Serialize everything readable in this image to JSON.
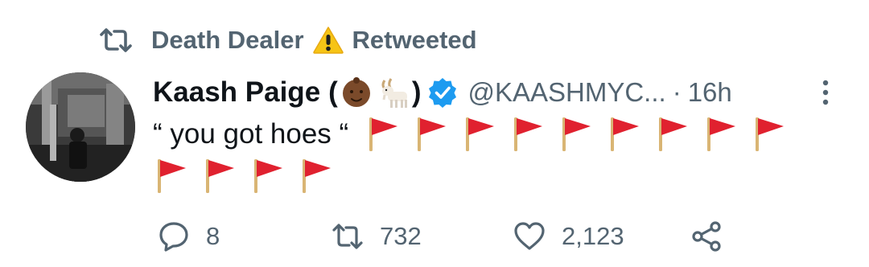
{
  "retweet_banner": {
    "retweeter_name": "Death Dealer",
    "warning_emoji": "⚠️",
    "label": "Retweeted"
  },
  "tweet": {
    "display_name": "Kaash Paige",
    "name_paren_open": "(",
    "name_paren_close": ")",
    "name_emojis": [
      "baby-medium-dark-skin-emoji",
      "goat-emoji"
    ],
    "verified": true,
    "handle": "@KAASHMYC...",
    "separator": "·",
    "timestamp": "16h",
    "text": "“ you got hoes “",
    "flags_line1_count": 9,
    "flags_line2_count": 4,
    "flag_emoji": "triangular-flag-emoji"
  },
  "actions": {
    "reply_count": "8",
    "retweet_count": "732",
    "like_count": "2,123"
  },
  "colors": {
    "text_primary": "#0f1419",
    "text_secondary": "#536471",
    "verified_blue": "#1d9bf0",
    "flag_red": "#e0212f"
  }
}
